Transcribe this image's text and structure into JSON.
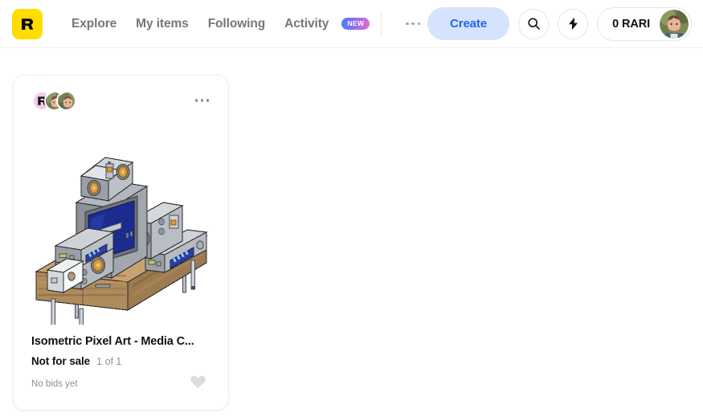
{
  "header": {
    "logo": {
      "name": "rarible-logo",
      "letter": "R",
      "color": "#ffdd00"
    },
    "nav": [
      {
        "label": "Explore",
        "name": "nav-explore"
      },
      {
        "label": "My items",
        "name": "nav-my-items"
      },
      {
        "label": "Following",
        "name": "nav-following"
      },
      {
        "label": "Activity",
        "name": "nav-activity",
        "badge": "NEW"
      }
    ],
    "more_menu_icon": "more-horizontal-icon",
    "create_label": "Create",
    "search_icon": "search-icon",
    "flash_icon": "lightning-bolt-icon",
    "wallet_balance": "0 RARI",
    "avatar_icon": "user-avatar",
    "accent_blue": "#2563ec",
    "create_bg": "#d5e3ff"
  },
  "card": {
    "creators_icon": "creator-avatar-group",
    "brand_avatar_letter": "R",
    "menu_icon": "more-horizontal-icon",
    "artwork": {
      "name": "isometric-pixel-art-media-center",
      "screen_color": "#1c2c8e",
      "wood_color": "#c8a06a",
      "device_color": "#b4b7bc",
      "cone_color": "#d79a3c"
    },
    "title": "Isometric Pixel Art - Media C...",
    "price_label": "Not for sale",
    "edition": "1 of 1",
    "bids": "No bids yet",
    "like_icon": "heart-icon",
    "like_color": "#dcdcdc"
  }
}
